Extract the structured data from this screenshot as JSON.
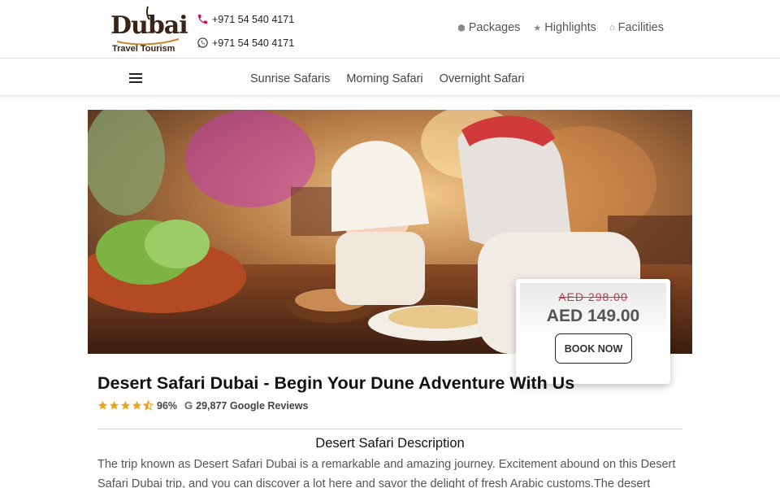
{
  "brand": {
    "logo_word": "Dubai",
    "logo_sub": "Travel Tourism"
  },
  "header": {
    "phone": "+971 54 540 4171",
    "whatsapp": "+971 54 540 4171",
    "nav": [
      {
        "label": "Packages",
        "icon": "cube-icon"
      },
      {
        "label": "Highlights",
        "icon": "star-icon"
      },
      {
        "label": "Facilities",
        "icon": "building-icon"
      }
    ]
  },
  "subnav": {
    "links": [
      "Sunrise Safaris",
      "Morning Safari",
      "Overnight Safari"
    ]
  },
  "offer": {
    "old_price": "AED 298.00",
    "new_price": "AED 149.00",
    "cta": "BOOK NOW"
  },
  "main": {
    "title": "Desert Safari Dubai - Begin Your Dune Adventure With Us",
    "rating_stars": 4.5,
    "rating_percent": "96%",
    "reviews": "29,877 Google Reviews",
    "section_title": "Desert Safari Description",
    "description": "The trip known as Desert Safari Dubai is a remarkable and amazing journey. Excitement abound on this Desert Safari Dubai trip, and you can discover a lot here and savor the delight of fresh Arabic customs.The desert"
  },
  "colors": {
    "accent_red": "#c0394b",
    "star_gold": "#e8a317",
    "phone_icon": "#c2185b"
  }
}
